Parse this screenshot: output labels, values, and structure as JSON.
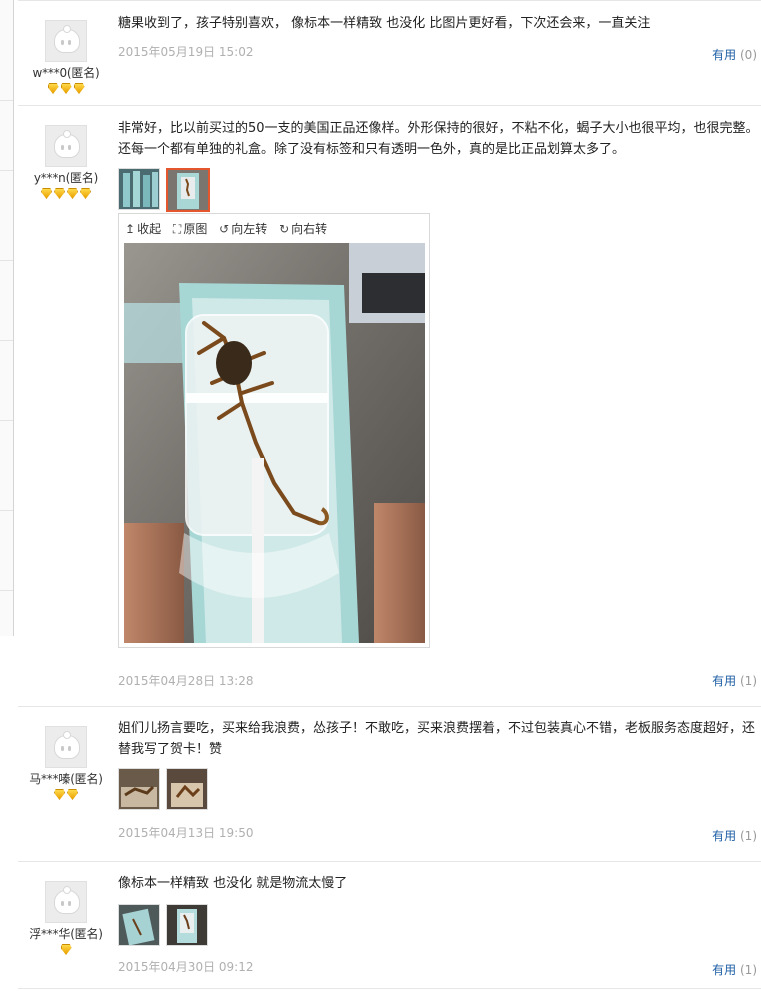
{
  "useful_label": "有用",
  "viewer": {
    "collapse_label": "收起",
    "original_label": "原图",
    "rotate_left_label": "向左转",
    "rotate_right_label": "向右转"
  },
  "reviews": [
    {
      "user": "w***0(匿名)",
      "level": 3,
      "text": "糖果收到了，孩子特别喜欢， 像标本一样精致 也没化 比图片更好看，下次还会来，一直关注",
      "date": "2015年05月19日 15:02",
      "useful_count": "(0)"
    },
    {
      "user": "y***n(匿名)",
      "level": 4,
      "text": "非常好，比以前买过的50一支的美国正品还像样。外形保持的很好，不粘不化，蝎子大小也很平均，也很完整。还每一个都有单独的礼盒。除了没有标签和只有透明一色外，真的是比正品划算太多了。",
      "date": "2015年04月28日 13:28",
      "useful_count": "(1)"
    },
    {
      "user": "马***嗪(匿名)",
      "level": 2,
      "text": "姐们儿扬言要吃，买来给我浪费，怂孩子！不敢吃，买来浪费摆着，不过包装真心不错，老板服务态度超好，还替我写了贺卡！赞",
      "date": "2015年04月13日 19:50",
      "useful_count": "(1)"
    },
    {
      "user": "浮***华(匿名)",
      "level": 1,
      "text": "像标本一样精致 也没化 就是物流太慢了",
      "date": "2015年04月30日 09:12",
      "useful_count": "(1)"
    }
  ],
  "colors": {
    "link_blue": "#1f5fa5",
    "date_gray": "#b0b0b0",
    "active_thumb_border": "#e4572e",
    "gem_gold": "#f5c000"
  }
}
